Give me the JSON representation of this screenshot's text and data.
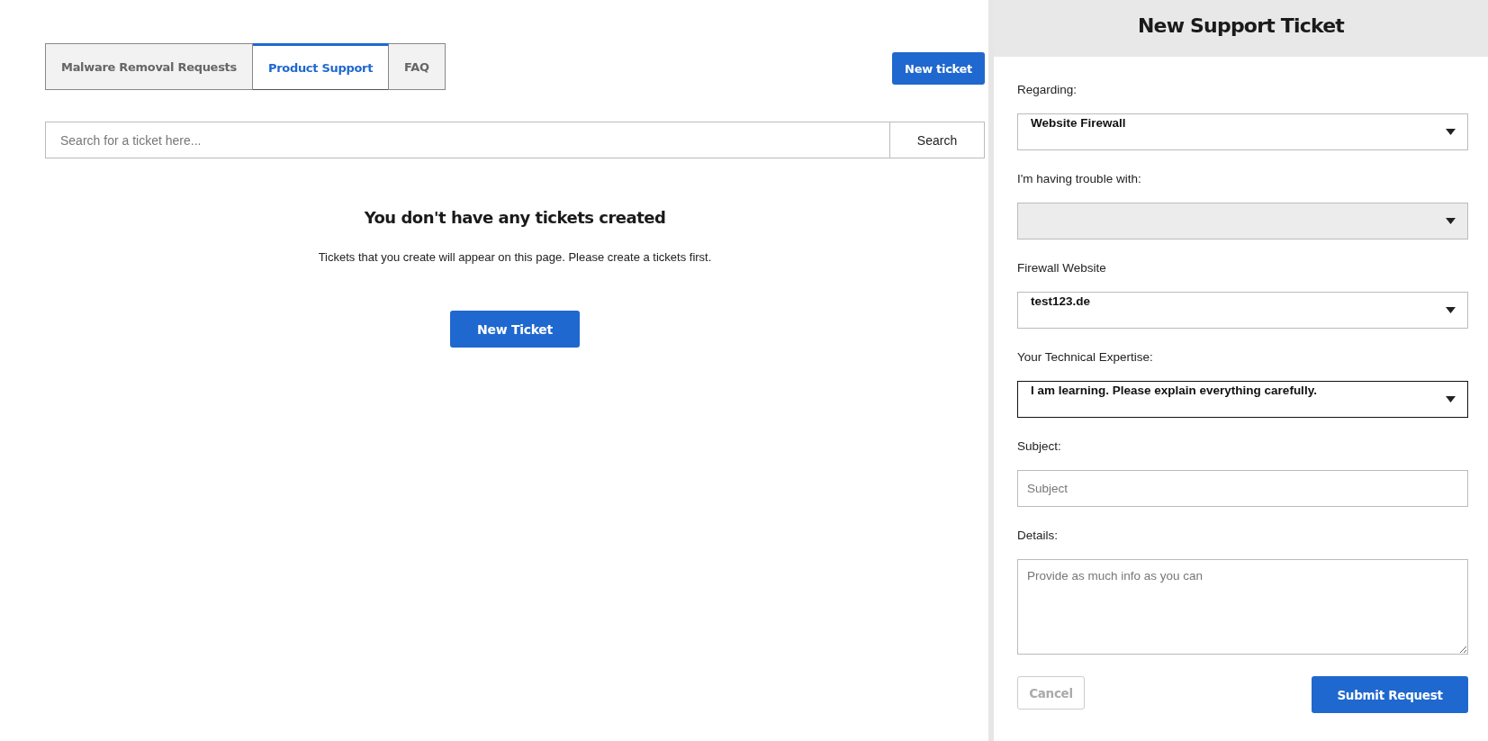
{
  "tabs": [
    {
      "label": "Malware Removal Requests",
      "selected": false
    },
    {
      "label": "Product Support",
      "selected": true
    },
    {
      "label": "FAQ",
      "selected": false
    }
  ],
  "new_ticket_button": "New ticket",
  "search": {
    "placeholder": "Search for a ticket here...",
    "button": "Search"
  },
  "empty_state": {
    "title": "You don't have any tickets created",
    "message": "Tickets that you create will appear on this page. Please create a tickets first.",
    "button": "New Ticket"
  },
  "panel": {
    "title": "New Support Ticket",
    "fields": [
      {
        "kind": "select",
        "label": "Regarding:",
        "value": "Website Firewall",
        "focused": false,
        "disabled": false
      },
      {
        "kind": "select",
        "label": "I'm having trouble with:",
        "focused": false,
        "disabled": true
      },
      {
        "kind": "select",
        "label": "Firewall Website",
        "value": "test123.de",
        "focused": false,
        "disabled": false
      },
      {
        "kind": "select",
        "label": "Your Technical Expertise:",
        "value": "I am learning. Please explain everything carefully.",
        "focused": true,
        "disabled": false
      },
      {
        "kind": "input",
        "label": "Subject:",
        "placeholder": "Subject"
      },
      {
        "kind": "textarea",
        "label": "Details:",
        "placeholder": "Provide as much info as you can"
      }
    ],
    "cancel_button": "Cancel",
    "submit_button": "Submit Request"
  }
}
